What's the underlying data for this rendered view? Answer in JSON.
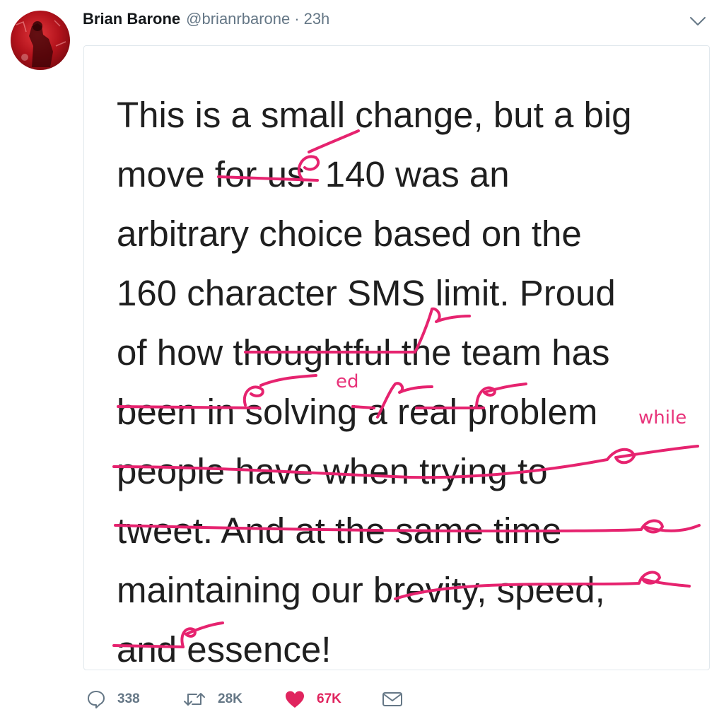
{
  "tweet": {
    "author_name": "Brian Barone",
    "author_handle": "@brianrbarone",
    "separator": "·",
    "time": "23h",
    "image": {
      "lines": [
        "This is a small change, but a big",
        "move for us. 140 was an",
        "arbitrary choice based on the",
        "160 character SMS limit. Proud",
        "of how thoughtful the team has",
        "been in solving a real problem",
        "people have when trying to",
        "tweet. And at the same time",
        "maintaining our brevity, speed,",
        "and essence!"
      ],
      "annotations": [
        "ed",
        "while"
      ],
      "ink_color": "#e6236f"
    },
    "actions": {
      "replies": "338",
      "retweets": "28K",
      "likes": "67K"
    },
    "colors": {
      "like_red": "#e0245e",
      "muted": "#657786",
      "border": "#e1e8ed"
    }
  }
}
